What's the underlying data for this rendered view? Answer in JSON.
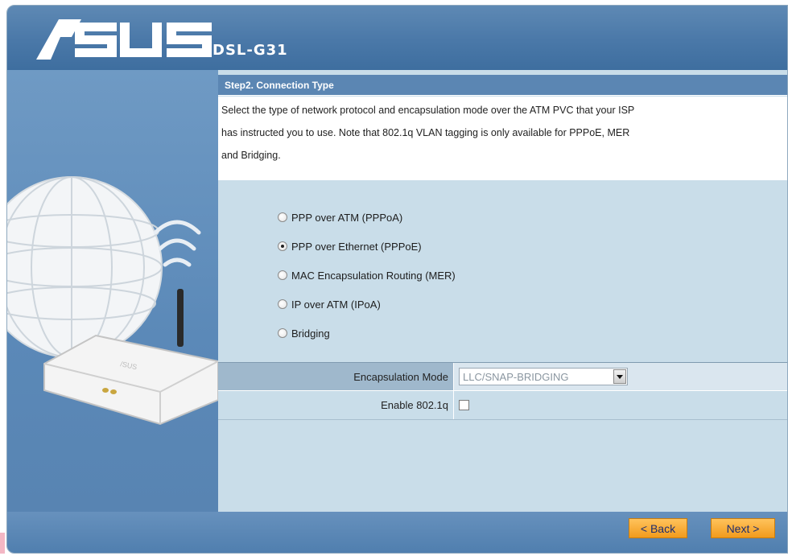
{
  "brand": {
    "logo_text": "/SUS",
    "model": "DSL-G31"
  },
  "step": {
    "title": "Step2. Connection Type",
    "description_lines": [
      "Select the type of network protocol and encapsulation mode over the ATM PVC that your ISP",
      "has instructed you to use. Note that 802.1q VLAN tagging is only available for PPPoE, MER",
      "and Bridging."
    ]
  },
  "connection_types": [
    {
      "label": "PPP over ATM (PPPoA)",
      "checked": false
    },
    {
      "label": "PPP over Ethernet (PPPoE)",
      "checked": true
    },
    {
      "label": "MAC Encapsulation Routing (MER)",
      "checked": false
    },
    {
      "label": "IP over ATM (IPoA)",
      "checked": false
    },
    {
      "label": "Bridging",
      "checked": false
    }
  ],
  "encapsulation": {
    "label": "Encapsulation Mode",
    "value": "LLC/SNAP-BRIDGING"
  },
  "vlan": {
    "label": "Enable 802.1q",
    "checked": false
  },
  "buttons": {
    "back": "< Back",
    "next": "Next >"
  },
  "colors": {
    "header": "#4a78a8",
    "accent_button": "#f29b1c",
    "panel": "#c9dde9"
  },
  "icons": [
    "globe-icon",
    "wifi-signal-icon",
    "router-icon",
    "dropdown-arrow-icon"
  ]
}
